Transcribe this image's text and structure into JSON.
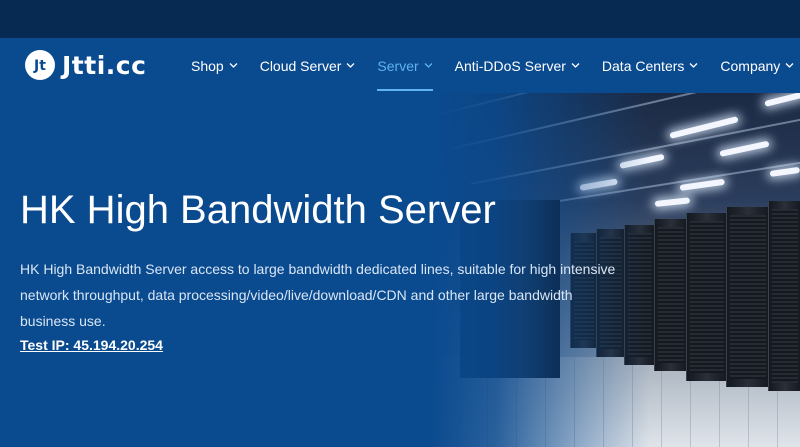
{
  "logo": {
    "mark": "Jt",
    "text": "Jtti.cc"
  },
  "nav": {
    "items": [
      {
        "label": "Shop"
      },
      {
        "label": "Cloud Server"
      },
      {
        "label": "Server"
      },
      {
        "label": "Anti-DDoS Server"
      },
      {
        "label": "Data Centers"
      },
      {
        "label": "Company"
      }
    ],
    "active": "Server"
  },
  "hero": {
    "title": "HK High Bandwidth Server",
    "description": "HK High Bandwidth Server access to large bandwidth dedicated lines, suitable for high intensive network throughput, data processing/video/live/download/CDN and other large bandwidth business use.",
    "test_ip": "Test IP: 45.194.20.254"
  },
  "colors": {
    "topbar": "#062a52",
    "nav_bg": "#0a4a8f",
    "active_accent": "#5fb3f0",
    "text": "#ffffff"
  },
  "icons": [
    "logo-mark-icon",
    "chevron-down-icon"
  ]
}
